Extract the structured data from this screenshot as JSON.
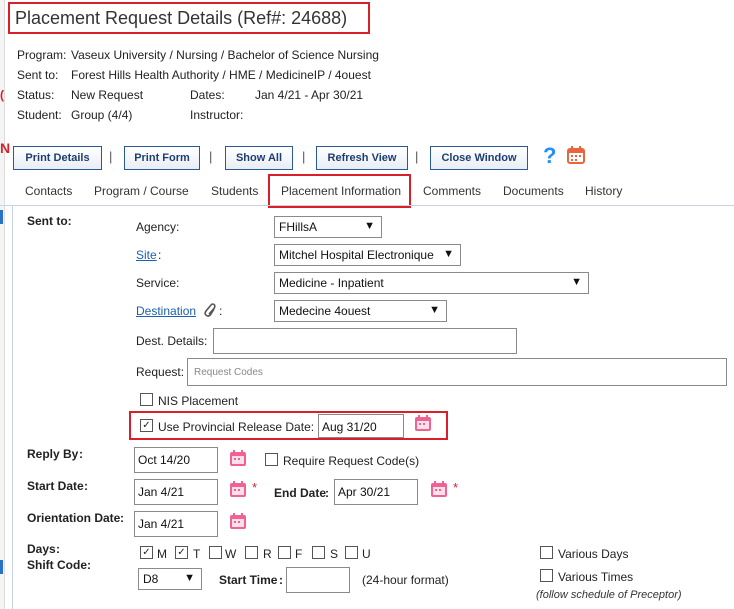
{
  "header": {
    "title": "Placement Request Details (Ref#: 24688)"
  },
  "summary": {
    "program_label": "Program:",
    "program_value": "Vaseux University / Nursing / Bachelor of Science Nursing",
    "sent_to_label": "Sent to:",
    "sent_to_value": "Forest Hills Health Authority / HME / MedicineIP / 4ouest",
    "status_label": "Status:",
    "status_value": "New Request",
    "dates_label": "Dates:",
    "dates_value": "Jan 4/21 - Apr 30/21",
    "student_label": "Student:",
    "student_value": "Group (4/4)",
    "instructor_label": "Instructor:",
    "instructor_value": ""
  },
  "toolbar": {
    "print_details": "Print Details",
    "print_form": "Print Form",
    "show_all": "Show All",
    "refresh_view": "Refresh View",
    "close_window": "Close Window",
    "separator": "|"
  },
  "tabs": [
    {
      "label": "Contacts"
    },
    {
      "label": "Program / Course"
    },
    {
      "label": "Students"
    },
    {
      "label": "Placement Information"
    },
    {
      "label": "Comments"
    },
    {
      "label": "Documents"
    },
    {
      "label": "History"
    }
  ],
  "form": {
    "sent_to_heading": "Sent to:",
    "agency_label": "Agency:",
    "agency_value": "FHillsA",
    "site_label": "Site",
    "site_colon": ":",
    "site_value": "Mitchel Hospital Electronique",
    "service_label": "Service:",
    "service_value": "Medicine - Inpatient",
    "destination_label": "Destination",
    "destination_colon": ":",
    "destination_value": "Medecine 4ouest",
    "dest_details_label": "Dest. Details:",
    "dest_details_value": "",
    "request_label": "Request:",
    "request_placeholder": "Request Codes",
    "nis_placement_label": "NIS Placement",
    "provincial_release_label": "Use Provincial Release Date:",
    "provincial_release_value": "Aug 31/20",
    "reply_by_label": "Reply By",
    "reply_by_colon": ":",
    "reply_by_value": "Oct 14/20",
    "require_code_label": "Require Request Code(s)",
    "start_date_label": "Start Date",
    "start_date_colon": ":",
    "start_date_value": "Jan 4/21",
    "end_date_label": "End Date",
    "end_date_colon": ":",
    "end_date_value": "Apr 30/21",
    "required_star": "*",
    "orientation_label": "Orientation Date",
    "orientation_colon": ":",
    "orientation_value": "Jan 4/21",
    "days_label": "Days",
    "days_colon": ":",
    "days": [
      {
        "label": "M",
        "checked": true
      },
      {
        "label": "T",
        "checked": true
      },
      {
        "label": "W",
        "checked": false
      },
      {
        "label": "R",
        "checked": false
      },
      {
        "label": "F",
        "checked": false
      },
      {
        "label": "S",
        "checked": false
      },
      {
        "label": "U",
        "checked": false
      }
    ],
    "various_days_label": "Various Days",
    "various_times_label": "Various Times",
    "preceptor_note": "(follow schedule of Preceptor)",
    "shift_code_label": "Shift Code",
    "shift_code_colon": ":",
    "shift_code_value": "D8",
    "start_time_label": "Start Time",
    "start_time_colon": ":",
    "start_time_value": "",
    "time_format_note": "(24-hour format)"
  },
  "icons": {
    "help": "question-mark-icon",
    "calendar": "calendar-icon",
    "attachment": "paperclip-icon",
    "dropdown": "chevron-down-icon"
  },
  "colors": {
    "highlight_red": "#d81f2a",
    "link_blue": "#1a5fb0",
    "calendar_pink": "#f06292",
    "help_blue": "#1e90ff",
    "calendar_orange": "#e8663d"
  }
}
